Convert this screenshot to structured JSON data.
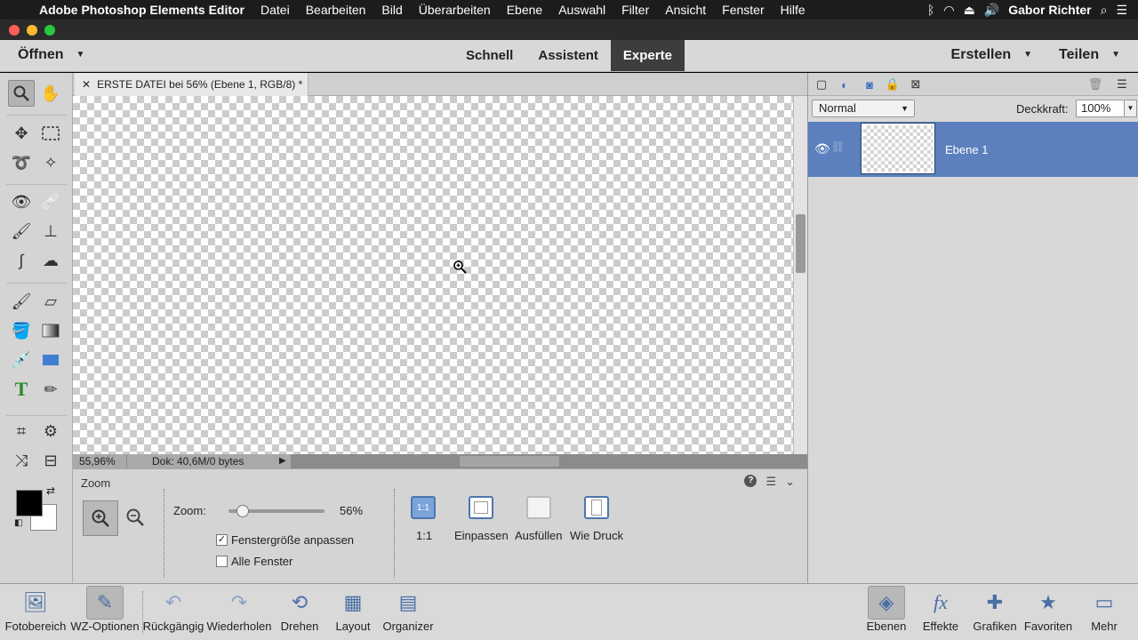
{
  "menubar": {
    "app_name": "Adobe Photoshop Elements Editor",
    "items": [
      "Datei",
      "Bearbeiten",
      "Bild",
      "Überarbeiten",
      "Ebene",
      "Auswahl",
      "Filter",
      "Ansicht",
      "Fenster",
      "Hilfe"
    ],
    "user": "Gabor Richter"
  },
  "header": {
    "open_label": "Öffnen",
    "modes": [
      "Schnell",
      "Assistent",
      "Experte"
    ],
    "active_mode": "Experte",
    "create_label": "Erstellen",
    "share_label": "Teilen"
  },
  "document": {
    "tab_title": "ERSTE DATEI bei 56% (Ebene 1, RGB/8) *",
    "status_zoom": "55,96%",
    "status_doc": "Dok: 40,6M/0 bytes"
  },
  "tool_options": {
    "title": "Zoom",
    "zoom_label": "Zoom:",
    "zoom_value": "56%",
    "zoom_fraction": 0.1,
    "fit_window_label": "Fenstergröße anpassen",
    "fit_window_checked": true,
    "all_windows_label": "Alle Fenster",
    "all_windows_checked": false,
    "view_buttons": [
      {
        "icon_text": "1:1",
        "label": "1:1"
      },
      {
        "icon_text": "",
        "label": "Einpassen"
      },
      {
        "icon_text": "",
        "label": "Ausfüllen"
      },
      {
        "icon_text": "",
        "label": "Wie Druck"
      }
    ]
  },
  "layers": {
    "blend_mode": "Normal",
    "opacity_label": "Deckkraft:",
    "opacity_value": "100%",
    "items": [
      {
        "name": "Ebene 1",
        "visible": true
      }
    ]
  },
  "bottombar": {
    "items": [
      "Fotobereich",
      "WZ-Optionen",
      "Rückgängig",
      "Wiederholen",
      "Drehen",
      "Layout",
      "Organizer"
    ],
    "right_items": [
      "Ebenen",
      "Effekte",
      "Grafiken",
      "Favoriten",
      "Mehr"
    ]
  },
  "colors": {
    "accent": "#5b80bd",
    "foreground": "#000000",
    "background": "#ffffff"
  }
}
